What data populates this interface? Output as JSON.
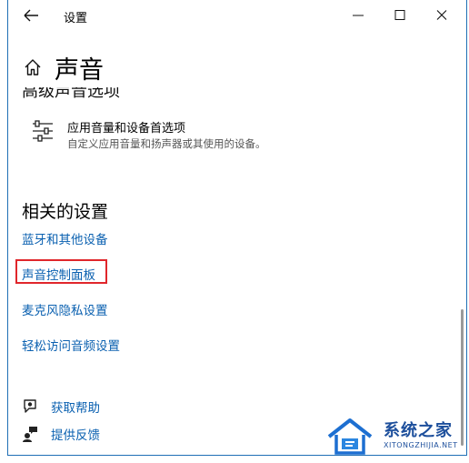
{
  "window": {
    "title": "设置",
    "minimize_glyph": "minimize-icon",
    "maximize_glyph": "maximize-icon",
    "close_glyph": "close-icon"
  },
  "header": {
    "title": "声音"
  },
  "advanced": {
    "section_title": "高级声音选项",
    "option_title": "应用音量和设备首选项",
    "option_desc": "自定义应用音量和扬声器或其使用的设备。"
  },
  "related": {
    "heading": "相关的设置",
    "links": [
      "蓝牙和其他设备",
      "声音控制面板",
      "麦克风隐私设置",
      "轻松访问音频设置"
    ]
  },
  "help": {
    "get_help": "获取帮助",
    "feedback": "提供反馈"
  },
  "watermark": {
    "main": "系统之家",
    "sub": "XITONGZHIJIA.NET"
  },
  "colors": {
    "link": "#0a60b0",
    "highlight_border": "#e0262b",
    "window_border": "#1f6fb5"
  }
}
